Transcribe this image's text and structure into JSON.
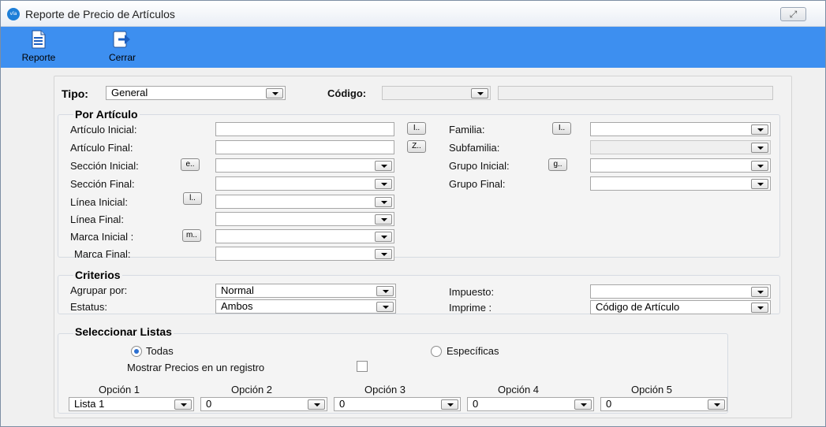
{
  "window": {
    "app_icon_text": "vla",
    "title": "Reporte de Precio de Artículos",
    "close_glyph": "⤢"
  },
  "toolbar": {
    "reporte_label": "Reporte",
    "cerrar_label": "Cerrar",
    "colors": {
      "bar": "#3d8ff0"
    }
  },
  "top": {
    "tipo_label": "Tipo:",
    "tipo_value": "General",
    "codigo_label": "Código:",
    "codigo_value": "",
    "codigo_desc": ""
  },
  "por_articulo": {
    "title": "Por Artículo",
    "articulo_inicial_label": "Artículo Inicial:",
    "articulo_inicial_hotkey": "I..",
    "articulo_inicial_value": "",
    "articulo_final_label": "Artículo Final:",
    "articulo_final_hotkey": "Z..",
    "articulo_final_value": "",
    "seccion_inicial_label": "Sección Inicial:",
    "seccion_inicial_hotkey": "e..",
    "seccion_inicial_value": "",
    "seccion_final_label": "Sección Final:",
    "seccion_final_value": "",
    "linea_inicial_label": "Línea Inicial:",
    "linea_inicial_hotkey": "l..",
    "linea_inicial_value": "",
    "linea_final_label": "Línea Final:",
    "linea_final_value": "",
    "marca_inicial_label": "Marca Inicial :",
    "marca_inicial_hotkey": "m..",
    "marca_inicial_value": "",
    "marca_final_label": "Marca Final:",
    "marca_final_value": "",
    "familia_label": "Familia:",
    "familia_hotkey": "I..",
    "familia_value": "",
    "subfamilia_label": "Subfamilia:",
    "subfamilia_value": "",
    "grupo_inicial_label": "Grupo Inicial:",
    "grupo_inicial_hotkey": "g..",
    "grupo_inicial_value": "",
    "grupo_final_label": "Grupo Final:",
    "grupo_final_value": ""
  },
  "criterios": {
    "title": "Criterios",
    "agrupar_label": "Agrupar por:",
    "agrupar_value": "Normal",
    "estatus_label": "Estatus:",
    "estatus_value": "Ambos",
    "impuesto_label": "Impuesto:",
    "impuesto_value": "",
    "imprime_label": "Imprime :",
    "imprime_value": "Código de Artículo"
  },
  "listas": {
    "title": "Seleccionar Listas",
    "todas_label": "Todas",
    "todas_selected": true,
    "especificas_label": "Específicas",
    "mostrar_label": "Mostrar Precios en un registro",
    "mostrar_checked": false,
    "opciones": [
      {
        "label": "Opción 1",
        "value": "Lista 1"
      },
      {
        "label": "Opción 2",
        "value": "0"
      },
      {
        "label": "Opción 3",
        "value": "0"
      },
      {
        "label": "Opción 4",
        "value": "0"
      },
      {
        "label": "Opción 5",
        "value": "0"
      }
    ]
  }
}
